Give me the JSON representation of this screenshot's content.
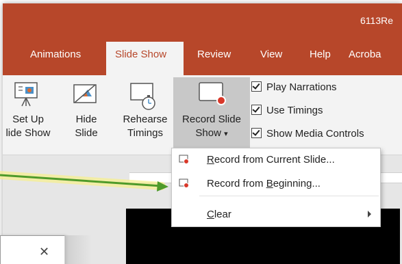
{
  "window": {
    "title": "6113Re"
  },
  "tabs": [
    {
      "label": "Animations"
    },
    {
      "label": "Slide Show",
      "active": true
    },
    {
      "label": "Review"
    },
    {
      "label": "View"
    },
    {
      "label": "Help"
    },
    {
      "label": "Acroba"
    }
  ],
  "ribbon": {
    "setup": {
      "line1": "Set Up",
      "line2": "lide Show"
    },
    "hide": {
      "line1": "Hide",
      "line2": "Slide"
    },
    "rehearse": {
      "line1": "Rehearse",
      "line2": "Timings"
    },
    "record": {
      "line1": "Record Slide",
      "line2": "Show",
      "caret": "▾"
    },
    "checkboxes": [
      {
        "label": "Play Narrations",
        "checked": true
      },
      {
        "label": "Use Timings",
        "checked": true
      },
      {
        "label": "Show Media Controls",
        "checked": true
      }
    ]
  },
  "dropdown": {
    "item1": {
      "prefix": "",
      "hotkey": "R",
      "rest": "ecord from Current Slide..."
    },
    "item2": {
      "prefix": "Record from ",
      "hotkey": "B",
      "rest": "eginning..."
    },
    "item3": {
      "prefix": "",
      "hotkey": "C",
      "rest": "lear"
    }
  },
  "dialog": {
    "close_glyph": "✕"
  },
  "colors": {
    "accent": "#b7472a",
    "record_dot": "#d9382a",
    "arrow": "#4e9a2a",
    "arrow_glow": "#f6f08a"
  }
}
